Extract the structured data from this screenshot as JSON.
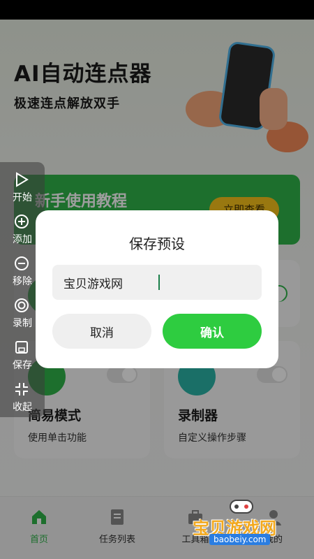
{
  "app": {
    "title": "AI自动连点器",
    "subtitle": "极速连点解放双手"
  },
  "tutorial": {
    "title": "新手使用教程",
    "button_label": "立即查看"
  },
  "cards": [
    {
      "name": "",
      "desc": ""
    },
    {
      "name": "",
      "desc": ""
    },
    {
      "name": "简易模式",
      "desc": "使用单击功能",
      "icon": "hand-tap-icon"
    },
    {
      "name": "录制器",
      "desc": "自定义操作步骤",
      "icon": "record-icon"
    }
  ],
  "nav": {
    "items": [
      {
        "label": "首页",
        "icon": "home-icon",
        "active": true
      },
      {
        "label": "任务列表",
        "icon": "list-icon",
        "active": false
      },
      {
        "label": "工具箱",
        "icon": "toolbox-icon",
        "active": false
      },
      {
        "label": "我的",
        "icon": "profile-icon",
        "active": false
      }
    ]
  },
  "toolbar": {
    "items": [
      {
        "label": "开始",
        "icon": "play-icon"
      },
      {
        "label": "添加",
        "icon": "plus-circle-icon"
      },
      {
        "label": "移除",
        "icon": "minus-circle-icon"
      },
      {
        "label": "录制",
        "icon": "record-icon"
      },
      {
        "label": "保存",
        "icon": "save-icon"
      },
      {
        "label": "收起",
        "icon": "collapse-icon"
      }
    ]
  },
  "dialog": {
    "title": "保存预设",
    "input_value": "宝贝游戏网",
    "cancel_label": "取消",
    "confirm_label": "确认"
  },
  "watermark": {
    "text": "宝贝游戏网",
    "url": "baobeiy.com"
  },
  "colors": {
    "accent": "#2ecc40",
    "banner": "#2fb34a",
    "banner_button": "#f7c21b"
  }
}
